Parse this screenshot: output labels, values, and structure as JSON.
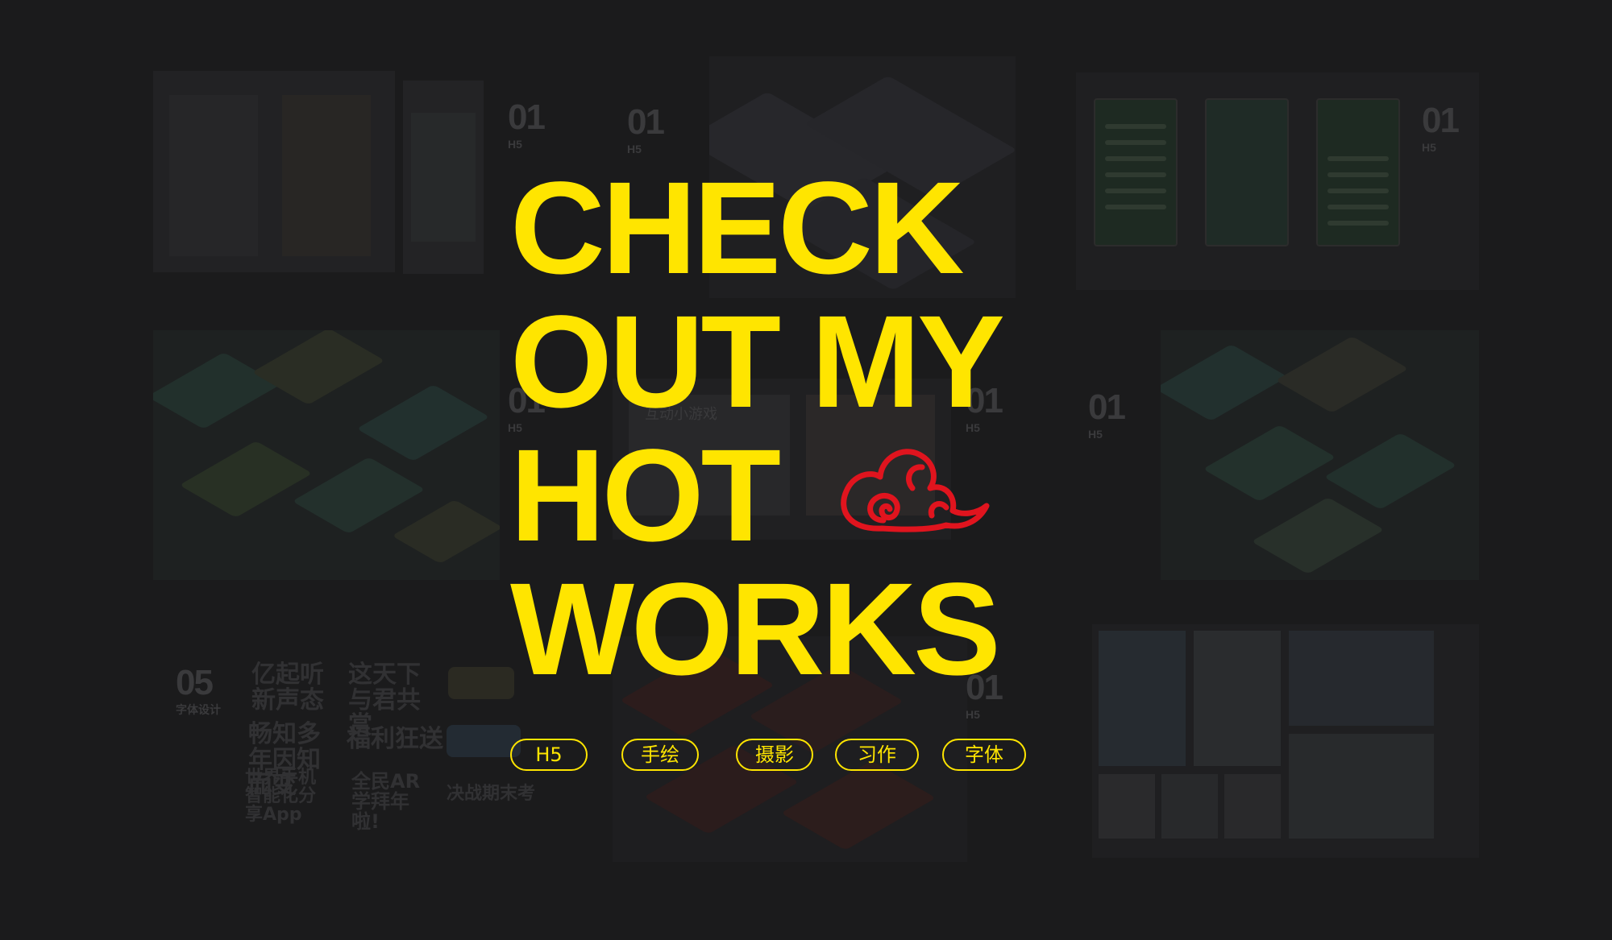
{
  "headline": {
    "line1": "CHECK",
    "line2": "OUT MY",
    "line3": "HOT",
    "line4": "WORKS"
  },
  "tags": [
    "H5",
    "手绘",
    "摄影",
    "习作",
    "字体"
  ],
  "background_panels": {
    "panel_numbers": [
      "01",
      "01",
      "01",
      "01",
      "01",
      "01",
      "05",
      "01"
    ],
    "panel_subtitles": [
      "H5",
      "H5",
      "H5",
      "H5",
      "H5",
      "H5",
      "字体设计",
      "H5"
    ],
    "calligraphy": [
      "亿起听新声态",
      "这天下与君共赏",
      "畅知多年因知而变",
      "福利狂送",
      "世界手机智能化分享App",
      "全民AR学拜年啦!",
      "决战期末考"
    ],
    "screen_text": "互动小游戏"
  },
  "colors": {
    "background": "#1b1b1c",
    "accent_yellow": "#ffe500",
    "cloud_red": "#e0141e"
  },
  "icons": [
    "auspicious-cloud-icon"
  ]
}
